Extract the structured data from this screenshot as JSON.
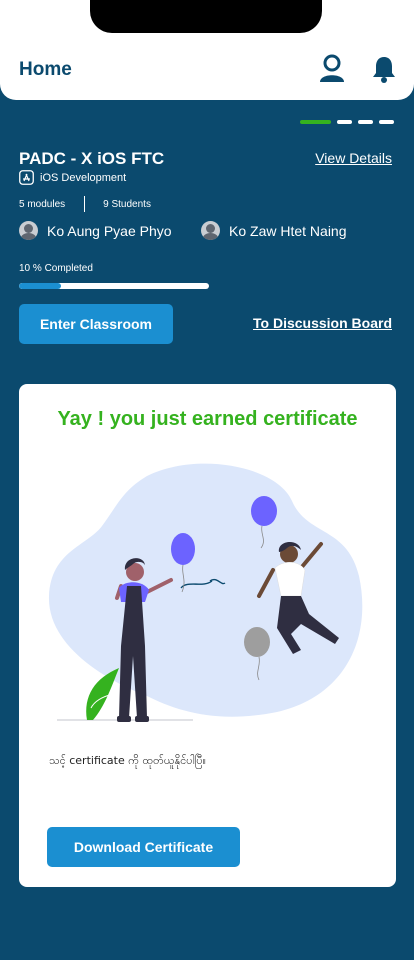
{
  "header": {
    "title": "Home",
    "icons": [
      "user-icon",
      "bell-icon"
    ]
  },
  "pager": {
    "total": 4,
    "active": 1,
    "active_color": "#35b21f"
  },
  "course": {
    "title": "PADC - X iOS FTC",
    "view_details": "View Details",
    "category": "iOS Development",
    "modules": "5 modules",
    "students": "9 Students",
    "teachers": [
      "Ko Aung Pyae Phyo",
      "Ko Zaw Htet Naing"
    ],
    "progress_label": "10 % Completed",
    "progress_fraction": 0.22,
    "enter_classroom": "Enter Classroom",
    "discussion_board": "To Discussion Board"
  },
  "certificate_card": {
    "title": "Yay ! you just earned certificate",
    "message": "သင့် certificate ကို ထုတ်ယူနိုင်ပါပြီ။",
    "download_button": "Download Certificate"
  },
  "colors": {
    "background": "#0b4a6e",
    "accent_blue": "#1b8fd1",
    "success_green": "#35b21f",
    "balloon_purple": "#6c63ff"
  }
}
